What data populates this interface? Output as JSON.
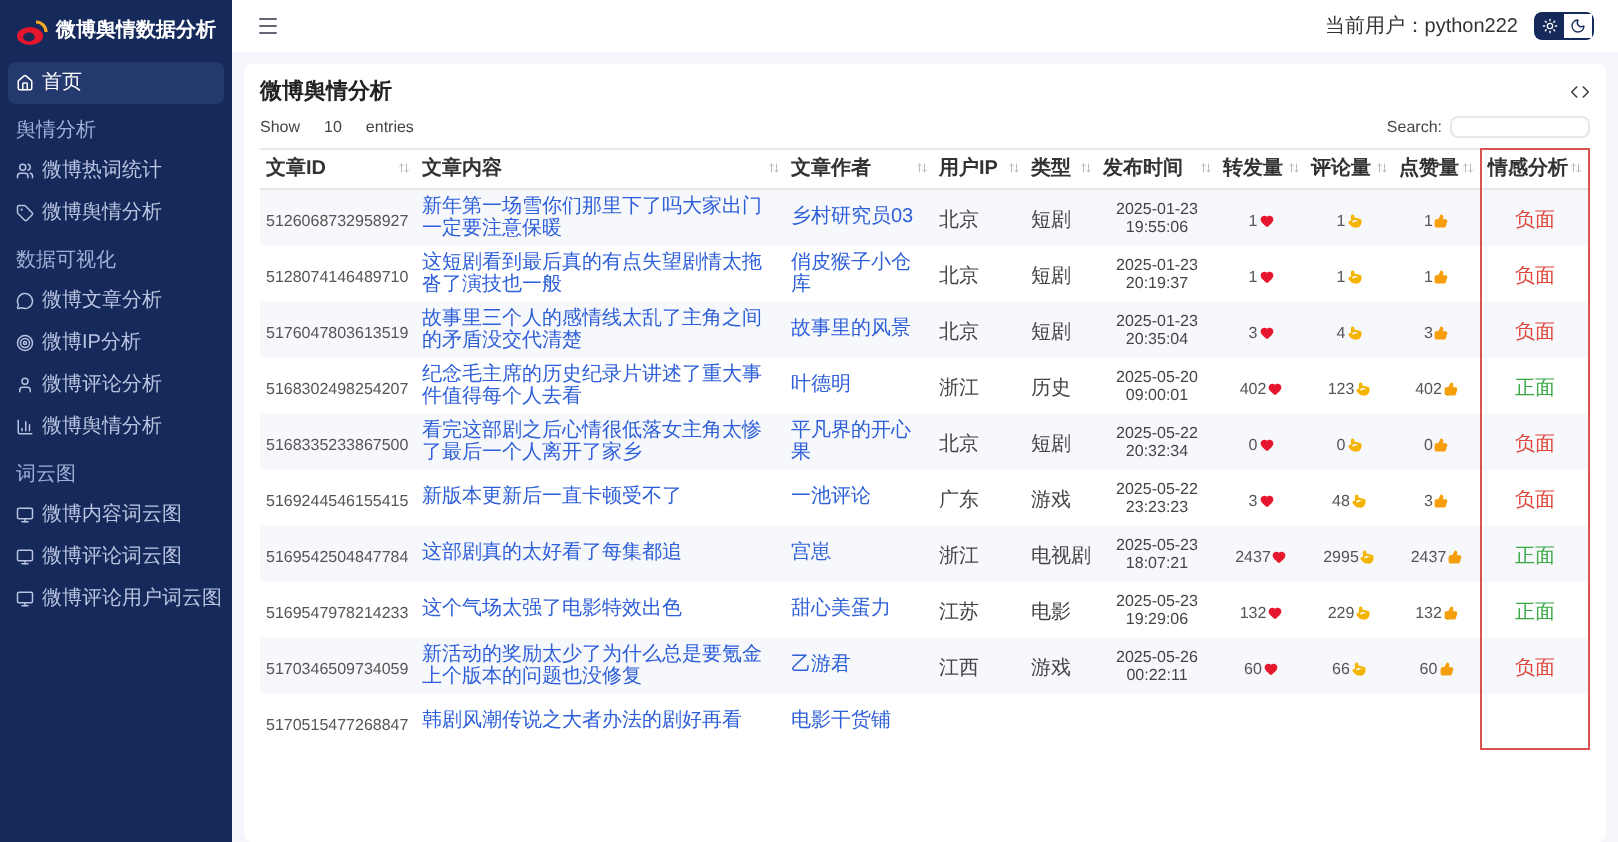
{
  "sidebar": {
    "logo_title": "微博舆情数据分析",
    "sections": [
      {
        "items": [
          {
            "label": "首页",
            "selected": true
          }
        ]
      },
      {
        "title": "舆情分析",
        "items": [
          {
            "label": "微博热词统计",
            "selected": false
          },
          {
            "label": "微博舆情分析",
            "selected": false
          }
        ]
      },
      {
        "title": "数据可视化",
        "items": [
          {
            "label": "微博文章分析",
            "selected": false
          },
          {
            "label": "微博IP分析",
            "selected": false
          },
          {
            "label": "微博评论分析",
            "selected": false
          },
          {
            "label": "微博舆情分析",
            "selected": false
          }
        ]
      },
      {
        "title": "词云图",
        "items": [
          {
            "label": "微博内容词云图",
            "selected": false
          },
          {
            "label": "微博评论词云图",
            "selected": false
          },
          {
            "label": "微博评论用户词云图",
            "selected": false
          }
        ]
      }
    ]
  },
  "header": {
    "user_label": "当前用户：python222",
    "theme": [
      {
        "kind": "light",
        "selected": true
      },
      {
        "kind": "dark",
        "selected": false
      }
    ]
  },
  "card": {
    "title": "微博舆情分析",
    "show_label": "Show",
    "page_size": "10",
    "entries_label": "entries",
    "search_label": "Search:"
  },
  "table": {
    "columns": [
      {
        "label": "文章ID",
        "highlighted": false
      },
      {
        "label": "文章内容",
        "highlighted": false
      },
      {
        "label": "文章作者",
        "highlighted": false
      },
      {
        "label": "用户IP",
        "highlighted": false
      },
      {
        "label": "类型",
        "highlighted": false
      },
      {
        "label": "发布时间",
        "highlighted": false
      },
      {
        "label": "转发量",
        "highlighted": false
      },
      {
        "label": "评论量",
        "highlighted": false
      },
      {
        "label": "点赞量",
        "highlighted": false
      },
      {
        "label": "情感分析",
        "highlighted": true
      }
    ],
    "rows": [
      {
        "id": "5126068732958927",
        "content": "新年第一场雪你们那里下了吗大家出门一定要注意保暖",
        "author": "乡村研究员03",
        "ip": "北京",
        "type": "短剧",
        "date": "2025-01-23",
        "time": "19:55:06",
        "reposts": "1",
        "comments": "1",
        "likes": "1",
        "sentiment": {
          "label": "负面",
          "kind": "negative"
        }
      },
      {
        "id": "5128074146489710",
        "content": "这短剧看到最后真的有点失望剧情太拖沓了演技也一般",
        "author": "俏皮猴子小仓库",
        "ip": "北京",
        "type": "短剧",
        "date": "2025-01-23",
        "time": "20:19:37",
        "reposts": "1",
        "comments": "1",
        "likes": "1",
        "sentiment": {
          "label": "负面",
          "kind": "negative"
        }
      },
      {
        "id": "5176047803613519",
        "content": "故事里三个人的感情线太乱了主角之间的矛盾没交代清楚",
        "author": "故事里的风景",
        "ip": "北京",
        "type": "短剧",
        "date": "2025-01-23",
        "time": "20:35:04",
        "reposts": "3",
        "comments": "4",
        "likes": "3",
        "sentiment": {
          "label": "负面",
          "kind": "negative"
        }
      },
      {
        "id": "5168302498254207",
        "content": "纪念毛主席的历史纪录片讲述了重大事件值得每个人去看",
        "author": "叶德明",
        "ip": "浙江",
        "type": "历史",
        "date": "2025-05-20",
        "time": "09:00:01",
        "reposts": "402",
        "comments": "123",
        "likes": "402",
        "sentiment": {
          "label": "正面",
          "kind": "positive"
        }
      },
      {
        "id": "5168335233867500",
        "content": "看完这部剧之后心情很低落女主角太惨了最后一个人离开了家乡",
        "author": "平凡界的开心果",
        "ip": "北京",
        "type": "短剧",
        "date": "2025-05-22",
        "time": "20:32:34",
        "reposts": "0",
        "comments": "0",
        "likes": "0",
        "sentiment": {
          "label": "负面",
          "kind": "negative"
        }
      },
      {
        "id": "5169244546155415",
        "content": "新版本更新后一直卡顿受不了",
        "author": "一池评论",
        "ip": "广东",
        "type": "游戏",
        "date": "2025-05-22",
        "time": "23:23:23",
        "reposts": "3",
        "comments": "48",
        "likes": "3",
        "sentiment": {
          "label": "负面",
          "kind": "negative"
        }
      },
      {
        "id": "5169542504847784",
        "content": "这部剧真的太好看了每集都追",
        "author": "宫崽",
        "ip": "浙江",
        "type": "电视剧",
        "date": "2025-05-23",
        "time": "18:07:21",
        "reposts": "2437",
        "comments": "2995",
        "likes": "2437",
        "sentiment": {
          "label": "正面",
          "kind": "positive"
        }
      },
      {
        "id": "5169547978214233",
        "content": "这个气场太强了电影特效出色",
        "author": "甜心美蛋力",
        "ip": "江苏",
        "type": "电影",
        "date": "2025-05-23",
        "time": "19:29:06",
        "reposts": "132",
        "comments": "229",
        "likes": "132",
        "sentiment": {
          "label": "正面",
          "kind": "positive"
        }
      },
      {
        "id": "5170346509734059",
        "content": "新活动的奖励太少了为什么总是要氪金上个版本的问题也没修复",
        "author": "乙游君",
        "ip": "江西",
        "type": "游戏",
        "date": "2025-05-26",
        "time": "00:22:11",
        "reposts": "60",
        "comments": "66",
        "likes": "60",
        "sentiment": {
          "label": "负面",
          "kind": "negative"
        }
      },
      {
        "id": "5170515477268847",
        "content": "韩剧风潮传说之大者办法的剧好再看",
        "author": "电影干货铺"
      }
    ]
  }
}
